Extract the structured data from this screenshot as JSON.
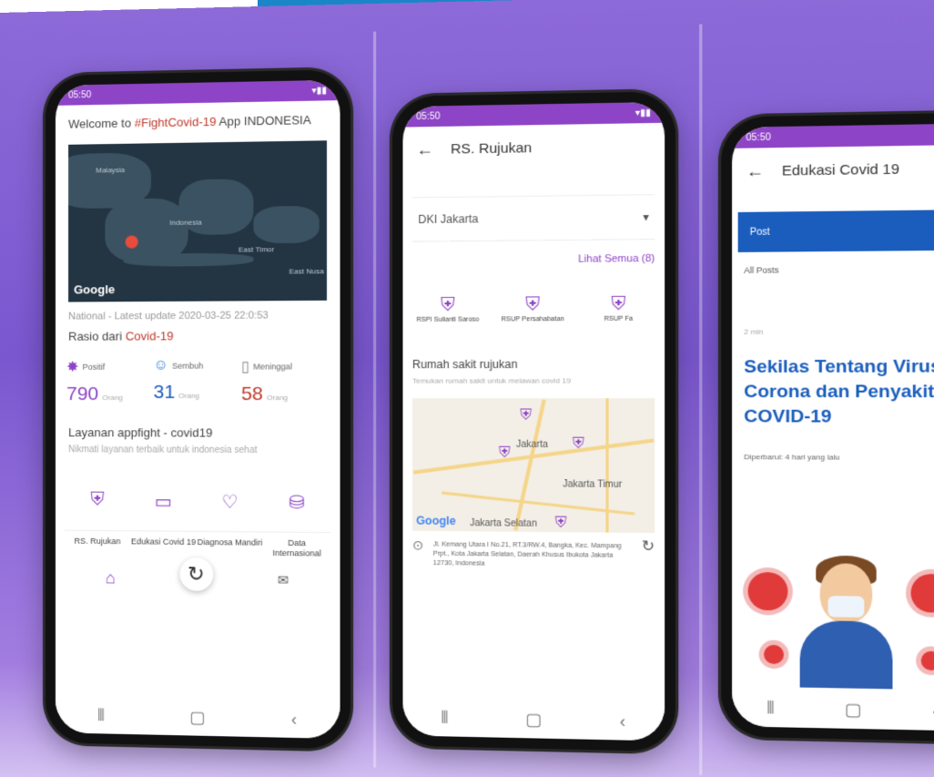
{
  "phones": {
    "home": {
      "status_time": "05:50",
      "welcome_prefix": "Welcome to",
      "welcome_tag": "#FightCovid-19",
      "welcome_suffix": "App INDONESIA",
      "map_labels": {
        "malaysia": "Malaysia",
        "indonesia": "Indonesia",
        "east_timor": "East Timor",
        "east_nusa": "East Nusa",
        "google": "Google"
      },
      "updated": "National - Latest update 2020-03-25 22:0:53",
      "rasio_prefix": "Rasio dari",
      "rasio_tag": "Covid-19",
      "stats": [
        {
          "label": "Positif",
          "value": "790",
          "unit": "Orang",
          "color": "#8e44c6"
        },
        {
          "label": "Sembuh",
          "value": "31",
          "unit": "Orang",
          "color": "#1a5dbd"
        },
        {
          "label": "Meninggal",
          "value": "58",
          "unit": "Orang",
          "color": "#c0392b"
        }
      ],
      "layanan_title": "Layanan appfight - covid19",
      "layanan_sub": "Nikmati layanan terbaik untuk indonesia sehat",
      "services": [
        {
          "label": "RS. Rujukan",
          "icon": "hospital-icon"
        },
        {
          "label": "Edukasi Covid 19",
          "icon": "book-icon"
        },
        {
          "label": "Diagnosa Mandiri",
          "icon": "stethoscope-icon"
        },
        {
          "label": "Data Internasional",
          "icon": "database-icon"
        }
      ]
    },
    "rujukan": {
      "status_time": "05:50",
      "title": "RS. Rujukan",
      "province": "DKI Jakarta",
      "lihat_semua": "Lihat Semua (8)",
      "hospitals": [
        "RSPI Sulianti Saroso",
        "RSUP Persahabatan",
        "RSUP Fa"
      ],
      "section_title": "Rumah sakit rujukan",
      "section_sub": "Temukan rumah sakit untuk melawan covid 19",
      "map_labels": {
        "jakarta": "Jakarta",
        "jakarta_timur": "Jakarta Timur",
        "jakarta_selatan": "Jakarta Selatan",
        "google": "Google"
      },
      "address": "Jl. Kemang Utara I No.21, RT.3/RW.4, Bangka, Kec. Mampang Prpt., Kota Jakarta Selatan, Daerah Khusus Ibukota Jakarta 12730, Indonesia"
    },
    "edukasi": {
      "status_time": "05:50",
      "title": "Edukasi Covid 19",
      "search_label": "Post",
      "filter": "All Posts",
      "meta": "2 min",
      "article_title": "Sekilas Tentang Virus Corona dan Penyakit COVID-19",
      "article_sub": "Diperbarui: 4 hari yang lalu"
    }
  }
}
